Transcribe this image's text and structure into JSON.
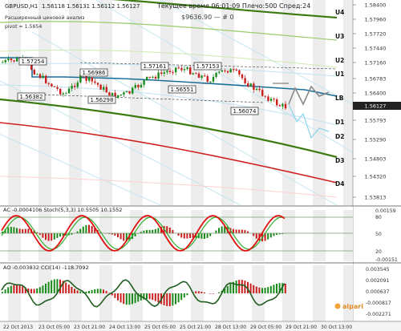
{
  "chart_header": {
    "symbol": "GBPUSD,H1",
    "ohlc": "1.56118 1.56131 1.56112 1.56127",
    "status": "Текущее время 06:01:09  Плечо:500  Спред:24",
    "balance": "$9636.90 — # 0",
    "indicator_name": "Расширенный ценовой анализ",
    "pivot_label": "pivot = 1.5654"
  },
  "level_labels": {
    "u4": "U4",
    "u3": "U3",
    "u2": "U2",
    "u1": "U1",
    "lb": "LB",
    "d1": "D1",
    "d2": "D2",
    "d3": "D3",
    "d4": "D4"
  },
  "price_scale": [
    "1.58400",
    "1.57960",
    "1.57720",
    "1.57440",
    "1.57160",
    "1.56783",
    "1.56400",
    "1.56127",
    "1.55793",
    "1.55290",
    "1.54803",
    "1.54320",
    "1.53813"
  ],
  "current_price": "1.56127",
  "annotations": [
    {
      "id": "a1",
      "text": "1.57254"
    },
    {
      "id": "a2",
      "text": "1.56986"
    },
    {
      "id": "a3",
      "text": "1.56382"
    },
    {
      "id": "a4",
      "text": "1.56298"
    },
    {
      "id": "a5",
      "text": "1.57161"
    },
    {
      "id": "a6",
      "text": "1.57153"
    },
    {
      "id": "a7",
      "text": "1.56551"
    },
    {
      "id": "a8",
      "text": "1.56074"
    }
  ],
  "ac_panel": {
    "title": "AC -0.0004106  Stoch(5,3,3) 10.5505 10.1552",
    "scale": [
      "0.00159",
      "80",
      "50",
      "20",
      "-0.00151"
    ]
  },
  "ao_panel": {
    "title": "AO -0.003832  CCI(14) -118.7092",
    "scale": [
      "0.003545",
      "0.002091",
      "0.000637",
      "-0.000817",
      "-0.002271"
    ]
  },
  "watermark": "alpari",
  "time_axis": [
    "22 Oct 2013",
    "23 Oct 05:00",
    "23 Oct 21:00",
    "24 Oct 13:00",
    "25 Oct 05:00",
    "25 Oct 21:00",
    "28 Oct 13:00",
    "29 Oct 05:00",
    "29 Oct 21:00",
    "30 Oct 13:00"
  ],
  "colors": {
    "bull": "#1a8a1a",
    "bear": "#c81e1e",
    "level_green": "#3a7a10",
    "level_red": "#d02020",
    "accent_blue": "#1a6f9a",
    "stoch_red": "#e01010",
    "stoch_green": "#30b030"
  }
}
